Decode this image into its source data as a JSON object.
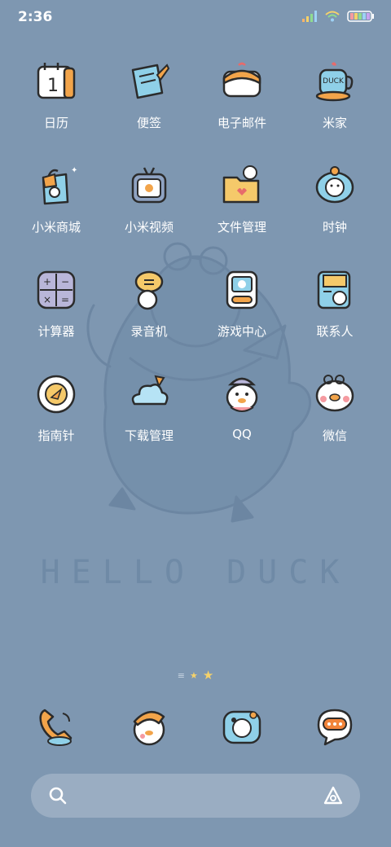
{
  "status": {
    "time": "2:36",
    "icons": [
      "signal-icon",
      "wifi-icon",
      "battery-icon"
    ]
  },
  "wallpaper": {
    "caption": "HELLO DUCK"
  },
  "apps": [
    {
      "label": "日历",
      "icon": "calendar-icon",
      "day": "1"
    },
    {
      "label": "便签",
      "icon": "notes-icon"
    },
    {
      "label": "电子邮件",
      "icon": "email-icon"
    },
    {
      "label": "米家",
      "icon": "duck-mug-icon",
      "mug_text": "DUCK"
    },
    {
      "label": "小米商城",
      "icon": "shopping-bag-icon"
    },
    {
      "label": "小米视频",
      "icon": "tv-icon"
    },
    {
      "label": "文件管理",
      "icon": "folder-icon"
    },
    {
      "label": "时钟",
      "icon": "clock-icon"
    },
    {
      "label": "计算器",
      "icon": "calculator-icon"
    },
    {
      "label": "录音机",
      "icon": "recorder-icon"
    },
    {
      "label": "游戏中心",
      "icon": "game-console-icon"
    },
    {
      "label": "联系人",
      "icon": "contacts-book-icon"
    },
    {
      "label": "指南针",
      "icon": "compass-icon"
    },
    {
      "label": "下载管理",
      "icon": "cloud-download-icon"
    },
    {
      "label": "QQ",
      "icon": "qq-duck-icon"
    },
    {
      "label": "微信",
      "icon": "wechat-duck-icon"
    }
  ],
  "pager": {
    "pages": [
      "menu-lines-icon",
      "star-icon",
      "star-icon"
    ],
    "active": 2
  },
  "dock": [
    {
      "icon": "phone-icon"
    },
    {
      "icon": "duck-hat-icon"
    },
    {
      "icon": "camera-duck-icon"
    },
    {
      "icon": "message-bubble-icon"
    }
  ],
  "colors": {
    "background": "#7e97b1",
    "accent_orange": "#f2a44a",
    "accent_blue": "#8fd0e8"
  }
}
